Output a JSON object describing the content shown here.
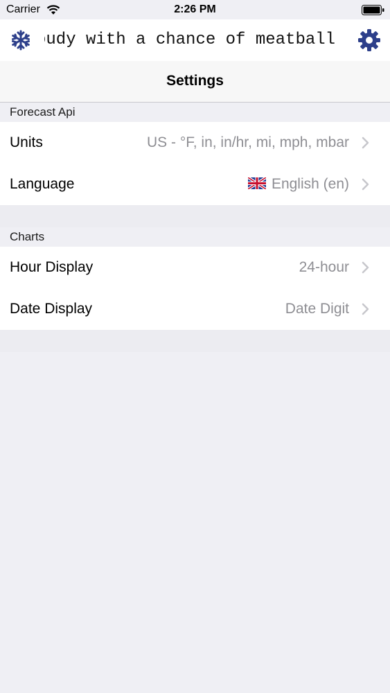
{
  "status_bar": {
    "carrier": "Carrier",
    "time": "2:26 PM"
  },
  "topbar": {
    "marquee_text": "oudy with a chance of meatball"
  },
  "nav": {
    "title": "Settings"
  },
  "sections": [
    {
      "header": "Forecast Api",
      "rows": [
        {
          "label": "Units",
          "value": "US - °F, in, in/hr, mi, mph, mbar"
        },
        {
          "label": "Language",
          "value": "English (en)",
          "flag": "uk-flag"
        }
      ]
    },
    {
      "header": "Charts",
      "rows": [
        {
          "label": "Hour Display",
          "value": "24-hour"
        },
        {
          "label": "Date Display",
          "value": "Date Digit"
        }
      ]
    }
  ],
  "colors": {
    "accent": "#2d3f8a",
    "background": "#efeff4",
    "value_gray": "#8e8e93",
    "chevron": "#c7c7cc"
  },
  "icons": {
    "left": "snowflake-icon",
    "right": "gear-icon",
    "row_disclosure": "chevron-right-icon"
  }
}
